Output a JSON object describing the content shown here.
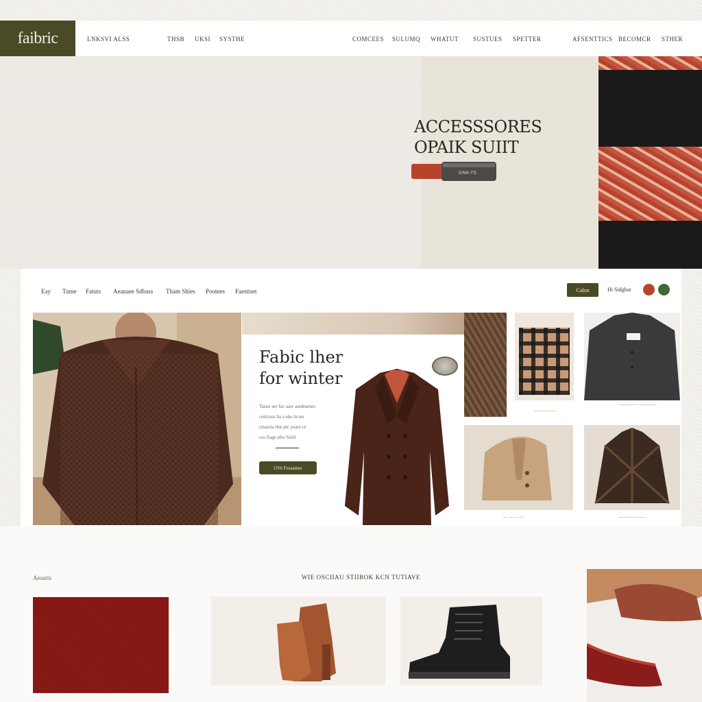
{
  "brand": {
    "logo": "faibric"
  },
  "header": {
    "nav_left": [
      "LNKSVI ALSS",
      "THSB",
      "UKSI",
      "SYSTHE"
    ],
    "nav_right": [
      "COMCEES",
      "SULUMQ",
      "WHATUT",
      "SUSTUES",
      "SPETTER",
      "AFSENTTICS",
      "BECOMCR",
      "STHER"
    ]
  },
  "hero": {
    "title_line1": "ACCESSSORES",
    "title_line2": "OPAIK SUIIT",
    "product_label": "GNA YS"
  },
  "card": {
    "subnav": [
      "Eay",
      "Tume",
      "Fatuts",
      "Aeanaee Sdbass",
      "Tham Shies",
      "Pootees",
      "Faesttset"
    ],
    "button_label": "Calon",
    "right_label": "Hi Sidgbat",
    "dot_colors": [
      "#b8432d",
      "#3e6b34"
    ],
    "feature": {
      "title_line1": "Fabic lher",
      "title_line2": "for winter",
      "body_lines": [
        "Tasnx ser fav aaw autdeaenrs",
        "cenivass ba a ebe iicses",
        "ctnarsta tfur ptc yeare ce",
        "ces fiage stbs Ssitd"
      ],
      "button_label": "OVe Fesasmes"
    },
    "captions": [
      "—————",
      "———— ————",
      "— — ——",
      "——— ———"
    ]
  },
  "bottom": {
    "label": "Aesarts",
    "heading": "WIE OSCIIAU STIIBOK KCN TUTIAVE"
  },
  "colors": {
    "accent": "#4a4a26",
    "rust": "#b8432d",
    "brown_coat": "#4a2a1e",
    "deep_red": "#7d1512"
  }
}
